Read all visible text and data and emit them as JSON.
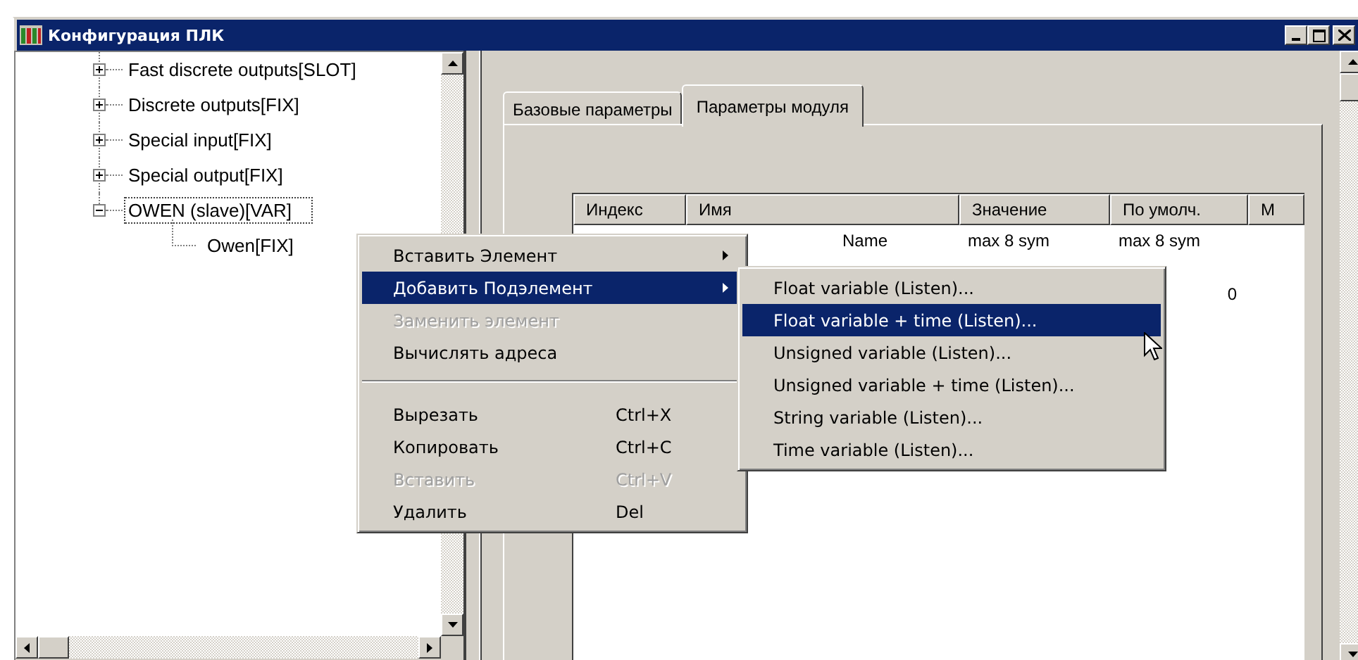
{
  "window": {
    "title": "Конфигурация ПЛК"
  },
  "tree": [
    {
      "label": "Fast discrete outputs[SLOT]",
      "expanded": false,
      "selected": false
    },
    {
      "label": "Discrete outputs[FIX]",
      "expanded": false,
      "selected": false
    },
    {
      "label": "Special input[FIX]",
      "expanded": false,
      "selected": false
    },
    {
      "label": "Special output[FIX]",
      "expanded": false,
      "selected": false
    },
    {
      "label": "OWEN (slave)[VAR]",
      "expanded": true,
      "selected": true,
      "children": [
        {
          "label": "Owen[FIX]",
          "selected": false
        }
      ]
    }
  ],
  "tabs": [
    {
      "label": "Базовые параметры",
      "selected": false
    },
    {
      "label": "Параметры модуля",
      "selected": true
    }
  ],
  "table": {
    "columns": [
      "Индекс",
      "Имя",
      "Значение",
      "По умолч.",
      "М"
    ],
    "rows": [
      [
        null,
        "Name",
        "max 8 sym",
        "max 8 sym",
        null
      ],
      [
        null,
        null,
        null,
        null,
        null
      ],
      [
        null,
        null,
        null,
        "0",
        null
      ]
    ]
  },
  "context_menu": [
    {
      "kind": "item",
      "label": "Вставить Элемент",
      "submenu": true,
      "disabled": false,
      "selected": false
    },
    {
      "kind": "item",
      "label": "Добавить Подэлемент",
      "submenu": true,
      "disabled": false,
      "selected": true
    },
    {
      "kind": "item",
      "label": "Заменить элемент",
      "submenu": false,
      "disabled": true,
      "selected": false
    },
    {
      "kind": "item",
      "label": "Вычислять адреса",
      "submenu": false,
      "disabled": false,
      "selected": false
    },
    {
      "kind": "separator"
    },
    {
      "kind": "item",
      "label": "Вырезать",
      "shortcut": "Ctrl+X",
      "submenu": false,
      "disabled": false,
      "selected": false
    },
    {
      "kind": "item",
      "label": "Копировать",
      "shortcut": "Ctrl+C",
      "submenu": false,
      "disabled": false,
      "selected": false
    },
    {
      "kind": "item",
      "label": "Вставить",
      "shortcut": "Ctrl+V",
      "submenu": false,
      "disabled": true,
      "selected": false
    },
    {
      "kind": "item",
      "label": "Удалить",
      "shortcut": "Del",
      "submenu": false,
      "disabled": false,
      "selected": false
    }
  ],
  "submenu": [
    {
      "label": "Float variable (Listen)...",
      "selected": false
    },
    {
      "label": "Float variable + time (Listen)...",
      "selected": true
    },
    {
      "label": "Unsigned variable (Listen)...",
      "selected": false
    },
    {
      "label": "Unsigned  variable + time (Listen)...",
      "selected": false
    },
    {
      "label": "String variable (Listen)...",
      "selected": false
    },
    {
      "label": "Time variable (Listen)...",
      "selected": false
    }
  ]
}
